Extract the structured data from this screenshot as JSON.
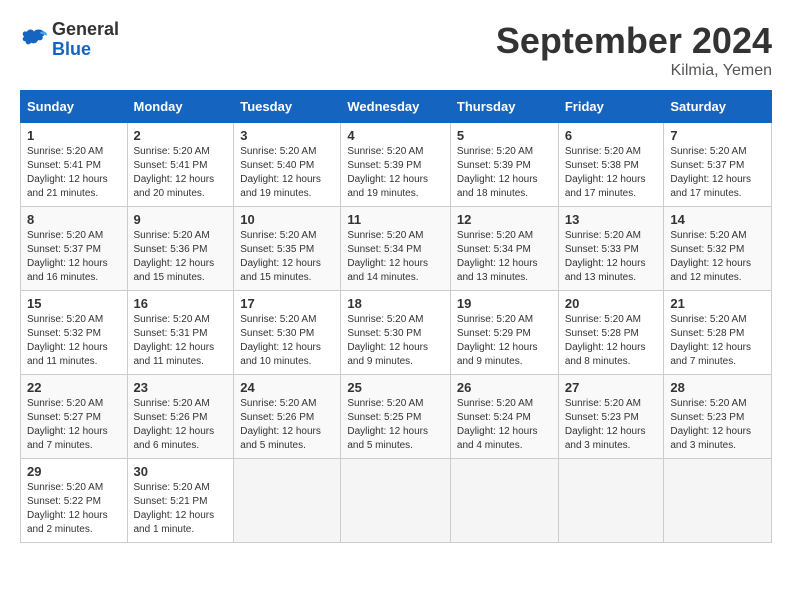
{
  "header": {
    "logo_general": "General",
    "logo_blue": "Blue",
    "month_title": "September 2024",
    "location": "Kilmia, Yemen"
  },
  "columns": [
    "Sunday",
    "Monday",
    "Tuesday",
    "Wednesday",
    "Thursday",
    "Friday",
    "Saturday"
  ],
  "weeks": [
    [
      {
        "day": "1",
        "info": "Sunrise: 5:20 AM\nSunset: 5:41 PM\nDaylight: 12 hours\nand 21 minutes."
      },
      {
        "day": "2",
        "info": "Sunrise: 5:20 AM\nSunset: 5:41 PM\nDaylight: 12 hours\nand 20 minutes."
      },
      {
        "day": "3",
        "info": "Sunrise: 5:20 AM\nSunset: 5:40 PM\nDaylight: 12 hours\nand 19 minutes."
      },
      {
        "day": "4",
        "info": "Sunrise: 5:20 AM\nSunset: 5:39 PM\nDaylight: 12 hours\nand 19 minutes."
      },
      {
        "day": "5",
        "info": "Sunrise: 5:20 AM\nSunset: 5:39 PM\nDaylight: 12 hours\nand 18 minutes."
      },
      {
        "day": "6",
        "info": "Sunrise: 5:20 AM\nSunset: 5:38 PM\nDaylight: 12 hours\nand 17 minutes."
      },
      {
        "day": "7",
        "info": "Sunrise: 5:20 AM\nSunset: 5:37 PM\nDaylight: 12 hours\nand 17 minutes."
      }
    ],
    [
      {
        "day": "8",
        "info": "Sunrise: 5:20 AM\nSunset: 5:37 PM\nDaylight: 12 hours\nand 16 minutes."
      },
      {
        "day": "9",
        "info": "Sunrise: 5:20 AM\nSunset: 5:36 PM\nDaylight: 12 hours\nand 15 minutes."
      },
      {
        "day": "10",
        "info": "Sunrise: 5:20 AM\nSunset: 5:35 PM\nDaylight: 12 hours\nand 15 minutes."
      },
      {
        "day": "11",
        "info": "Sunrise: 5:20 AM\nSunset: 5:34 PM\nDaylight: 12 hours\nand 14 minutes."
      },
      {
        "day": "12",
        "info": "Sunrise: 5:20 AM\nSunset: 5:34 PM\nDaylight: 12 hours\nand 13 minutes."
      },
      {
        "day": "13",
        "info": "Sunrise: 5:20 AM\nSunset: 5:33 PM\nDaylight: 12 hours\nand 13 minutes."
      },
      {
        "day": "14",
        "info": "Sunrise: 5:20 AM\nSunset: 5:32 PM\nDaylight: 12 hours\nand 12 minutes."
      }
    ],
    [
      {
        "day": "15",
        "info": "Sunrise: 5:20 AM\nSunset: 5:32 PM\nDaylight: 12 hours\nand 11 minutes."
      },
      {
        "day": "16",
        "info": "Sunrise: 5:20 AM\nSunset: 5:31 PM\nDaylight: 12 hours\nand 11 minutes."
      },
      {
        "day": "17",
        "info": "Sunrise: 5:20 AM\nSunset: 5:30 PM\nDaylight: 12 hours\nand 10 minutes."
      },
      {
        "day": "18",
        "info": "Sunrise: 5:20 AM\nSunset: 5:30 PM\nDaylight: 12 hours\nand 9 minutes."
      },
      {
        "day": "19",
        "info": "Sunrise: 5:20 AM\nSunset: 5:29 PM\nDaylight: 12 hours\nand 9 minutes."
      },
      {
        "day": "20",
        "info": "Sunrise: 5:20 AM\nSunset: 5:28 PM\nDaylight: 12 hours\nand 8 minutes."
      },
      {
        "day": "21",
        "info": "Sunrise: 5:20 AM\nSunset: 5:28 PM\nDaylight: 12 hours\nand 7 minutes."
      }
    ],
    [
      {
        "day": "22",
        "info": "Sunrise: 5:20 AM\nSunset: 5:27 PM\nDaylight: 12 hours\nand 7 minutes."
      },
      {
        "day": "23",
        "info": "Sunrise: 5:20 AM\nSunset: 5:26 PM\nDaylight: 12 hours\nand 6 minutes."
      },
      {
        "day": "24",
        "info": "Sunrise: 5:20 AM\nSunset: 5:26 PM\nDaylight: 12 hours\nand 5 minutes."
      },
      {
        "day": "25",
        "info": "Sunrise: 5:20 AM\nSunset: 5:25 PM\nDaylight: 12 hours\nand 5 minutes."
      },
      {
        "day": "26",
        "info": "Sunrise: 5:20 AM\nSunset: 5:24 PM\nDaylight: 12 hours\nand 4 minutes."
      },
      {
        "day": "27",
        "info": "Sunrise: 5:20 AM\nSunset: 5:23 PM\nDaylight: 12 hours\nand 3 minutes."
      },
      {
        "day": "28",
        "info": "Sunrise: 5:20 AM\nSunset: 5:23 PM\nDaylight: 12 hours\nand 3 minutes."
      }
    ],
    [
      {
        "day": "29",
        "info": "Sunrise: 5:20 AM\nSunset: 5:22 PM\nDaylight: 12 hours\nand 2 minutes."
      },
      {
        "day": "30",
        "info": "Sunrise: 5:20 AM\nSunset: 5:21 PM\nDaylight: 12 hours\nand 1 minute."
      },
      {
        "day": "",
        "info": ""
      },
      {
        "day": "",
        "info": ""
      },
      {
        "day": "",
        "info": ""
      },
      {
        "day": "",
        "info": ""
      },
      {
        "day": "",
        "info": ""
      }
    ]
  ]
}
